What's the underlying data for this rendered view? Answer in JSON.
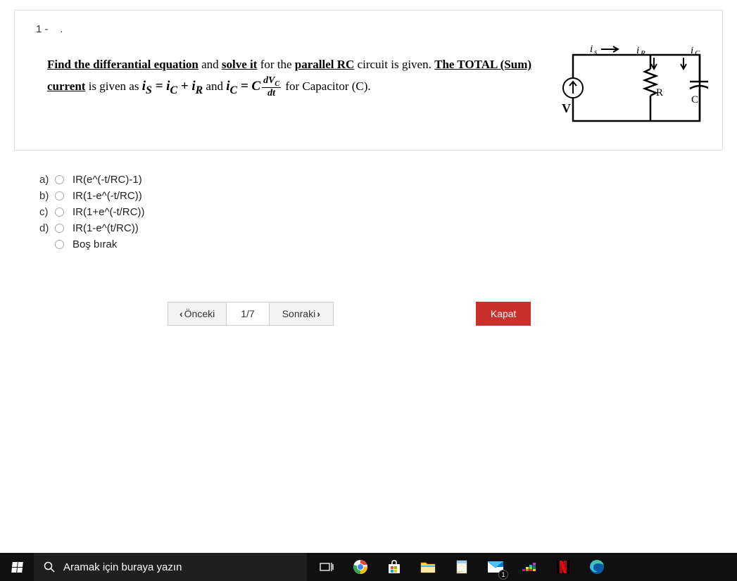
{
  "question": {
    "number": "1 -",
    "dot": ".",
    "text": {
      "p1a": "Find the differantial equation",
      "p1b": " and ",
      "p1c": "solve it",
      "p1d": "  for the ",
      "p1e": "parallel RC",
      "p1f": " circuit is given. ",
      "p2a": "The TOTAL (Sum) current",
      "p2b": " is given as  ",
      "eq1_is": "i",
      "eq1_s": "S",
      "eq1_eq": " = ",
      "eq1_ic": "i",
      "eq1_cs": "C",
      "eq1_plus": " + ",
      "eq1_ir": "i",
      "eq1_rs": "R",
      "p2c": " and   ",
      "eq2_ic": "i",
      "eq2_cs": "C",
      "eq2_eq": " = C",
      "eq2_num": "dV",
      "eq2_numc": "C",
      "eq2_den": "dt",
      "p2d": " for  Capacitor (C)."
    },
    "circuit": {
      "is": "i",
      "is_sub": "s",
      "ir": "i",
      "ir_sub": "R",
      "ic": "i",
      "ic_sub": "C",
      "V": "V",
      "R": "R",
      "C": "C"
    }
  },
  "options": [
    {
      "letter": "a)",
      "text": "IR(e^(-t/RC)-1)"
    },
    {
      "letter": "b)",
      "text": "IR(1-e^(-t/RC))"
    },
    {
      "letter": "c)",
      "text": "IR(1+e^(-t/RC))"
    },
    {
      "letter": "d)",
      "text": "IR(1-e^(t/RC))"
    },
    {
      "letter": "",
      "text": "Boş bırak"
    }
  ],
  "nav": {
    "prev": "Önceki",
    "counter": "1/7",
    "next": "Sonraki",
    "close": "Kapat"
  },
  "taskbar": {
    "search_placeholder": "Aramak için buraya yazın",
    "mail_badge": "1"
  }
}
